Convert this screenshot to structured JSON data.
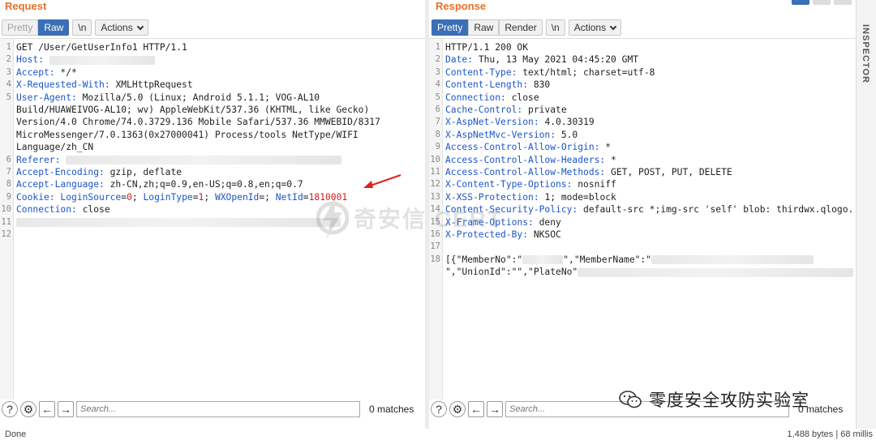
{
  "request": {
    "title": "Request",
    "toolbar": {
      "pretty": "Pretty",
      "raw": "Raw",
      "newline": "\\n",
      "actions": "Actions"
    },
    "lines": [
      {
        "n": "1",
        "parts": [
          {
            "t": "GET /User/GetUserInfo1 HTTP/1.1",
            "c": ""
          }
        ]
      },
      {
        "n": "2",
        "parts": [
          {
            "t": "Host: ",
            "c": "key"
          }
        ],
        "blur": 130
      },
      {
        "n": "3",
        "parts": [
          {
            "t": "Accept: ",
            "c": "key"
          },
          {
            "t": "*/*",
            "c": ""
          }
        ]
      },
      {
        "n": "4",
        "parts": [
          {
            "t": "X-Requested-With: ",
            "c": "key"
          },
          {
            "t": "XMLHttpRequest",
            "c": ""
          }
        ]
      },
      {
        "n": "5",
        "parts": [
          {
            "t": "User-Agent: ",
            "c": "key"
          },
          {
            "t": "Mozilla/5.0 (Linux; Android 5.1.1; VOG-AL10",
            "c": ""
          }
        ]
      },
      {
        "n": "",
        "parts": [
          {
            "t": "Build/HUAWEIVOG-AL10; wv) AppleWebKit/537.36 (KHTML, like Gecko)",
            "c": ""
          }
        ]
      },
      {
        "n": "",
        "parts": [
          {
            "t": "Version/4.0 Chrome/74.0.3729.136 Mobile Safari/537.36 MMWEBID/8317",
            "c": ""
          }
        ]
      },
      {
        "n": "",
        "parts": [
          {
            "t": "MicroMessenger/7.0.1363(0x27000041) Process/tools NetType/WIFI",
            "c": ""
          }
        ]
      },
      {
        "n": "",
        "parts": [
          {
            "t": "Language/zh_CN",
            "c": ""
          }
        ]
      },
      {
        "n": "6",
        "parts": [
          {
            "t": "Referer: ",
            "c": "key"
          }
        ],
        "blur": 340
      },
      {
        "n": "7",
        "parts": [
          {
            "t": "Accept-Encoding: ",
            "c": "key"
          },
          {
            "t": "gzip, deflate",
            "c": ""
          }
        ]
      },
      {
        "n": "8",
        "parts": [
          {
            "t": "Accept-Language: ",
            "c": "key"
          },
          {
            "t": "zh-CN,zh;q=0.9,en-US;q=0.8,en;q=0.7",
            "c": ""
          }
        ]
      },
      {
        "n": "9",
        "parts": [
          {
            "t": "Cookie: ",
            "c": "key"
          },
          {
            "t": "LoginSource",
            "c": "key"
          },
          {
            "t": "=",
            "c": ""
          },
          {
            "t": "0",
            "c": "num"
          },
          {
            "t": "; ",
            "c": ""
          },
          {
            "t": "LoginType",
            "c": "key"
          },
          {
            "t": "=",
            "c": ""
          },
          {
            "t": "1",
            "c": "num"
          },
          {
            "t": "; ",
            "c": ""
          },
          {
            "t": "WXOpenId",
            "c": "key"
          },
          {
            "t": "=; ",
            "c": ""
          },
          {
            "t": "NetId",
            "c": "key"
          },
          {
            "t": "=",
            "c": ""
          },
          {
            "t": "1810001",
            "c": "num"
          }
        ]
      },
      {
        "n": "10",
        "parts": [
          {
            "t": "Connection: ",
            "c": "key"
          },
          {
            "t": "close",
            "c": ""
          }
        ]
      },
      {
        "n": "11",
        "parts": [],
        "blur": 400
      },
      {
        "n": "12",
        "parts": []
      }
    ],
    "search_placeholder": "Search...",
    "matches": "0 matches"
  },
  "response": {
    "title": "Response",
    "toolbar": {
      "pretty": "Pretty",
      "raw": "Raw",
      "render": "Render",
      "newline": "\\n",
      "actions": "Actions"
    },
    "lines": [
      {
        "n": "1",
        "parts": [
          {
            "t": "HTTP/1.1 200 OK",
            "c": ""
          }
        ]
      },
      {
        "n": "2",
        "parts": [
          {
            "t": "Date: ",
            "c": "key"
          },
          {
            "t": "Thu, 13 May 2021 04:45:20 GMT",
            "c": ""
          }
        ]
      },
      {
        "n": "3",
        "parts": [
          {
            "t": "Content-Type: ",
            "c": "key"
          },
          {
            "t": "text/html; charset=utf-8",
            "c": ""
          }
        ]
      },
      {
        "n": "4",
        "parts": [
          {
            "t": "Content-Length: ",
            "c": "key"
          },
          {
            "t": "830",
            "c": ""
          }
        ]
      },
      {
        "n": "5",
        "parts": [
          {
            "t": "Connection: ",
            "c": "key"
          },
          {
            "t": "close",
            "c": ""
          }
        ]
      },
      {
        "n": "6",
        "parts": [
          {
            "t": "Cache-Control: ",
            "c": "key"
          },
          {
            "t": "private",
            "c": ""
          }
        ]
      },
      {
        "n": "7",
        "parts": [
          {
            "t": "X-AspNet-Version: ",
            "c": "key"
          },
          {
            "t": "4.0.30319",
            "c": ""
          }
        ]
      },
      {
        "n": "8",
        "parts": [
          {
            "t": "X-AspNetMvc-Version: ",
            "c": "key"
          },
          {
            "t": "5.0",
            "c": ""
          }
        ]
      },
      {
        "n": "9",
        "parts": [
          {
            "t": "Access-Control-Allow-Origin: ",
            "c": "key"
          },
          {
            "t": "*",
            "c": ""
          }
        ]
      },
      {
        "n": "10",
        "parts": [
          {
            "t": "Access-Control-Allow-Headers: ",
            "c": "key"
          },
          {
            "t": "*",
            "c": ""
          }
        ]
      },
      {
        "n": "11",
        "parts": [
          {
            "t": "Access-Control-Allow-Methods: ",
            "c": "key"
          },
          {
            "t": "GET, POST, PUT, DELETE",
            "c": ""
          }
        ]
      },
      {
        "n": "12",
        "parts": [
          {
            "t": "X-Content-Type-Options: ",
            "c": "key"
          },
          {
            "t": "nosniff",
            "c": ""
          }
        ]
      },
      {
        "n": "13",
        "parts": [
          {
            "t": "X-XSS-Protection: ",
            "c": "key"
          },
          {
            "t": "1; mode=block",
            "c": ""
          }
        ]
      },
      {
        "n": "14",
        "parts": [
          {
            "t": "Content-Security-Policy: ",
            "c": "key"
          },
          {
            "t": "default-src *;img-src 'self' blob: thirdwx.qlogo.",
            "c": ""
          }
        ]
      },
      {
        "n": "15",
        "parts": [
          {
            "t": "X-Frame-Options: ",
            "c": "key"
          },
          {
            "t": "deny",
            "c": ""
          }
        ]
      },
      {
        "n": "16",
        "parts": [
          {
            "t": "X-Protected-By: ",
            "c": "key"
          },
          {
            "t": "NKSOC",
            "c": ""
          }
        ]
      },
      {
        "n": "17",
        "parts": []
      },
      {
        "n": "18",
        "parts": [
          {
            "t": "[{\"MemberNo\":\"",
            "c": ""
          }
        ],
        "blur": 50,
        "after": [
          {
            "t": "\",\"MemberName\":\"",
            "c": ""
          }
        ],
        "blur2": 200
      },
      {
        "n": "",
        "parts": [
          {
            "t": "\",\"UnionId\":\"\",\"PlateNo\"",
            "c": ""
          }
        ],
        "blur": 340
      }
    ],
    "search_placeholder": "Search...",
    "matches": "0 matches"
  },
  "inspector": {
    "label": "INSPECTOR"
  },
  "status": {
    "left": "Done",
    "right": "1,488 bytes | 68 millis"
  },
  "watermark": {
    "text": "奇安信 CERT"
  },
  "wechat": {
    "text": "零度安全攻防实验室"
  },
  "colors": {
    "accent": "#e8702a",
    "key": "#1c55c9",
    "number": "#c81e1e",
    "active": "#3b6fb6"
  }
}
